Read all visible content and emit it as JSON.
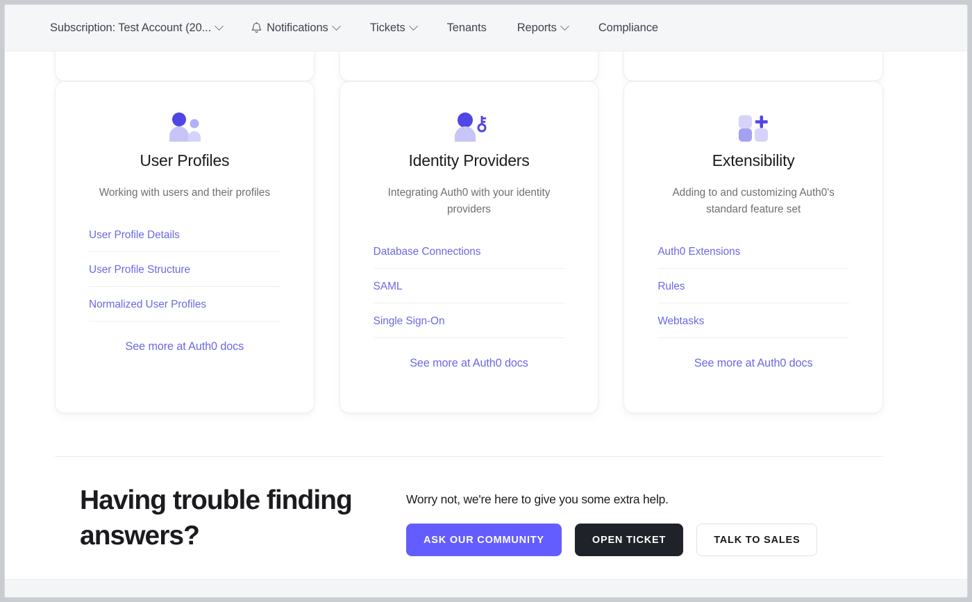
{
  "nav": {
    "items": [
      {
        "label": "Subscription: Test Account (20...",
        "icon": "",
        "caret": true
      },
      {
        "label": "Notifications",
        "icon": "bell-icon",
        "caret": true
      },
      {
        "label": "Tickets",
        "icon": "",
        "caret": true
      },
      {
        "label": "Tenants",
        "icon": "",
        "caret": false
      },
      {
        "label": "Reports",
        "icon": "",
        "caret": true
      },
      {
        "label": "Compliance",
        "icon": "",
        "caret": false
      }
    ]
  },
  "cards": [
    {
      "icon": "users-icon",
      "title": "User Profiles",
      "description": "Working with users and their profiles",
      "links": [
        "User Profile Details",
        "User Profile Structure",
        "Normalized User Profiles"
      ],
      "see_more": "See more at Auth0 docs"
    },
    {
      "icon": "user-key-icon",
      "title": "Identity Providers",
      "description": "Integrating Auth0 with your identity providers",
      "links": [
        "Database Connections",
        "SAML",
        "Single Sign-On"
      ],
      "see_more": "See more at Auth0 docs"
    },
    {
      "icon": "blocks-plus-icon",
      "title": "Extensibility",
      "description": "Adding to and customizing Auth0's standard feature set",
      "links": [
        "Auth0 Extensions",
        "Rules",
        "Webtasks"
      ],
      "see_more": "See more at Auth0 docs"
    }
  ],
  "help": {
    "heading": "Having trouble finding answers?",
    "subtitle": "Worry not, we're here to give you some extra help.",
    "buttons": [
      {
        "label": "ASK OUR COMMUNITY",
        "style": "primary"
      },
      {
        "label": "OPEN TICKET",
        "style": "dark"
      },
      {
        "label": "TALK TO SALES",
        "style": "outline"
      }
    ]
  },
  "colors": {
    "accent": "#635dff",
    "link": "#6a69e4",
    "icon_dark": "#4f46e5",
    "icon_light": "#c7c5f8",
    "dark_button": "#1f2228",
    "nav_background": "#f5f6f8"
  }
}
